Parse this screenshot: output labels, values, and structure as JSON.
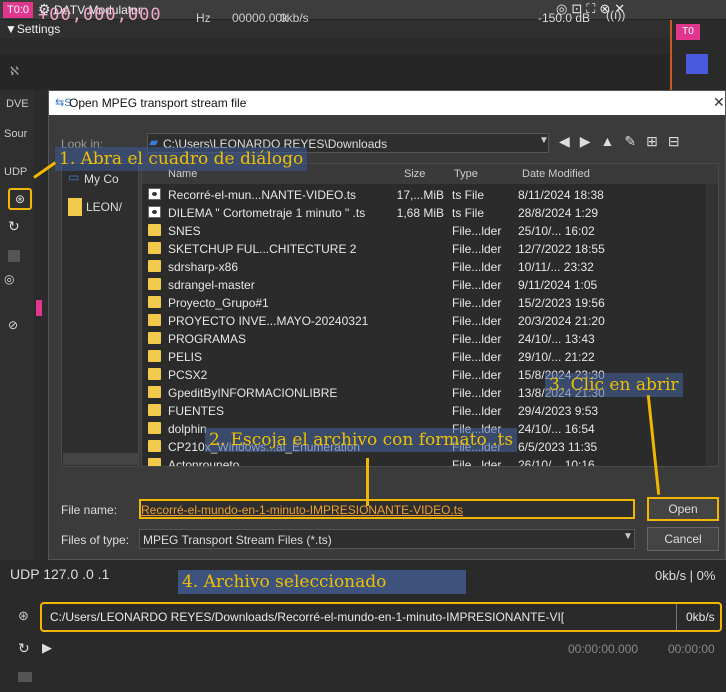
{
  "app": {
    "title": "DATV Modulator",
    "badge": "T0:0",
    "badge_right": "T0"
  },
  "settings": {
    "label": "▼Settings"
  },
  "freq": {
    "icon": "ℵ",
    "value": "+00,000,000",
    "unit": "Hz",
    "k": "00000.00k",
    "bitrate": "0kb/s",
    "level": "-150.0 dB"
  },
  "left_labels": {
    "dvb": "DVE",
    "sour": "Sour",
    "udp": "UDP"
  },
  "dialog": {
    "title": "Open MPEG transport stream file",
    "look_in_label": "Look in:",
    "look_in_path": "C:\\Users\\LEONARDO REYES\\Downloads",
    "sidebar": [
      "My Co",
      "LEON/"
    ],
    "columns": {
      "name": "Name",
      "size": "Size",
      "type": "Type",
      "date": "Date Modified"
    },
    "files": [
      {
        "name": "Recorré-el-mun...NANTE-VIDEO.ts",
        "size": "17,...MiB",
        "type": "ts File",
        "date": "8/11/2024 18:38",
        "kind": "ts"
      },
      {
        "name": "DILEMA \" Cortometraje 1 minuto \" .ts",
        "size": "1,68 MiB",
        "type": "ts File",
        "date": "28/8/2024 1:29",
        "kind": "ts"
      },
      {
        "name": "SNES",
        "size": "",
        "type": "File...lder",
        "date": "25/10/... 16:02",
        "kind": "folder"
      },
      {
        "name": "SKETCHUP FUL...CHITECTURE 2",
        "size": "",
        "type": "File...lder",
        "date": "12/7/2022 18:55",
        "kind": "folder"
      },
      {
        "name": "sdrsharp-x86",
        "size": "",
        "type": "File...lder",
        "date": "10/11/... 23:32",
        "kind": "folder"
      },
      {
        "name": "sdrangel-master",
        "size": "",
        "type": "File...lder",
        "date": "9/11/2024 1:05",
        "kind": "folder"
      },
      {
        "name": "Proyecto_Grupo#1",
        "size": "",
        "type": "File...lder",
        "date": "15/2/2023 19:56",
        "kind": "folder"
      },
      {
        "name": "PROYECTO INVE...MAYO-20240321",
        "size": "",
        "type": "File...lder",
        "date": "20/3/2024 21:20",
        "kind": "folder"
      },
      {
        "name": "PROGRAMAS",
        "size": "",
        "type": "File...lder",
        "date": "24/10/... 13:43",
        "kind": "folder"
      },
      {
        "name": "PELIS",
        "size": "",
        "type": "File...lder",
        "date": "29/10/... 21:22",
        "kind": "folder"
      },
      {
        "name": "PCSX2",
        "size": "",
        "type": "File...lder",
        "date": "15/8/2024 23:30",
        "kind": "folder"
      },
      {
        "name": "GpeditByINFORMACIONLIBRE",
        "size": "",
        "type": "File...lder",
        "date": "13/8/2024 21:30",
        "kind": "folder"
      },
      {
        "name": "FUENTES",
        "size": "",
        "type": "File...lder",
        "date": "29/4/2023 9:53",
        "kind": "folder"
      },
      {
        "name": "dolphin",
        "size": "",
        "type": "File...lder",
        "date": "24/10/... 16:54",
        "kind": "folder"
      },
      {
        "name": "CP210x_Windows...al_Enumeration",
        "size": "",
        "type": "File...lder",
        "date": "6/5/2023 11:35",
        "kind": "folder"
      },
      {
        "name": "Actonrouneto",
        "size": "",
        "type": "File...lder",
        "date": "26/10/... 10:16",
        "kind": "folder"
      }
    ],
    "file_name_label": "File name:",
    "file_name_value": "Recorré-el-mundo-en-1-minuto-IMPRESIONANTE-VIDEO.ts",
    "file_type_label": "Files of type:",
    "file_type_value": "MPEG Transport Stream Files (*.ts)",
    "open_label": "Open",
    "cancel_label": "Cancel"
  },
  "annotations": {
    "step1": "1. Abra el cuadro de diálogo",
    "step2": "2. Escoja el archivo con formato .ts",
    "step3": "3. Clic en abrir",
    "step4": "4. Archivo seleccionado"
  },
  "bottom": {
    "udp": "UDP 127.0 .0 .1",
    "kbs": "0kb/s | 0%",
    "path": "C:/Users/LEONARDO REYES/Downloads/Recorré-el-mundo-en-1-minuto-IMPRESIONANTE-VI[",
    "path_kbs": "0kb/s",
    "time1": "00:00:00.000",
    "time2": "00:00:00"
  },
  "colors": {
    "accent": "#f0b600",
    "badge": "#e0368e",
    "frame": "#c65b1f"
  }
}
